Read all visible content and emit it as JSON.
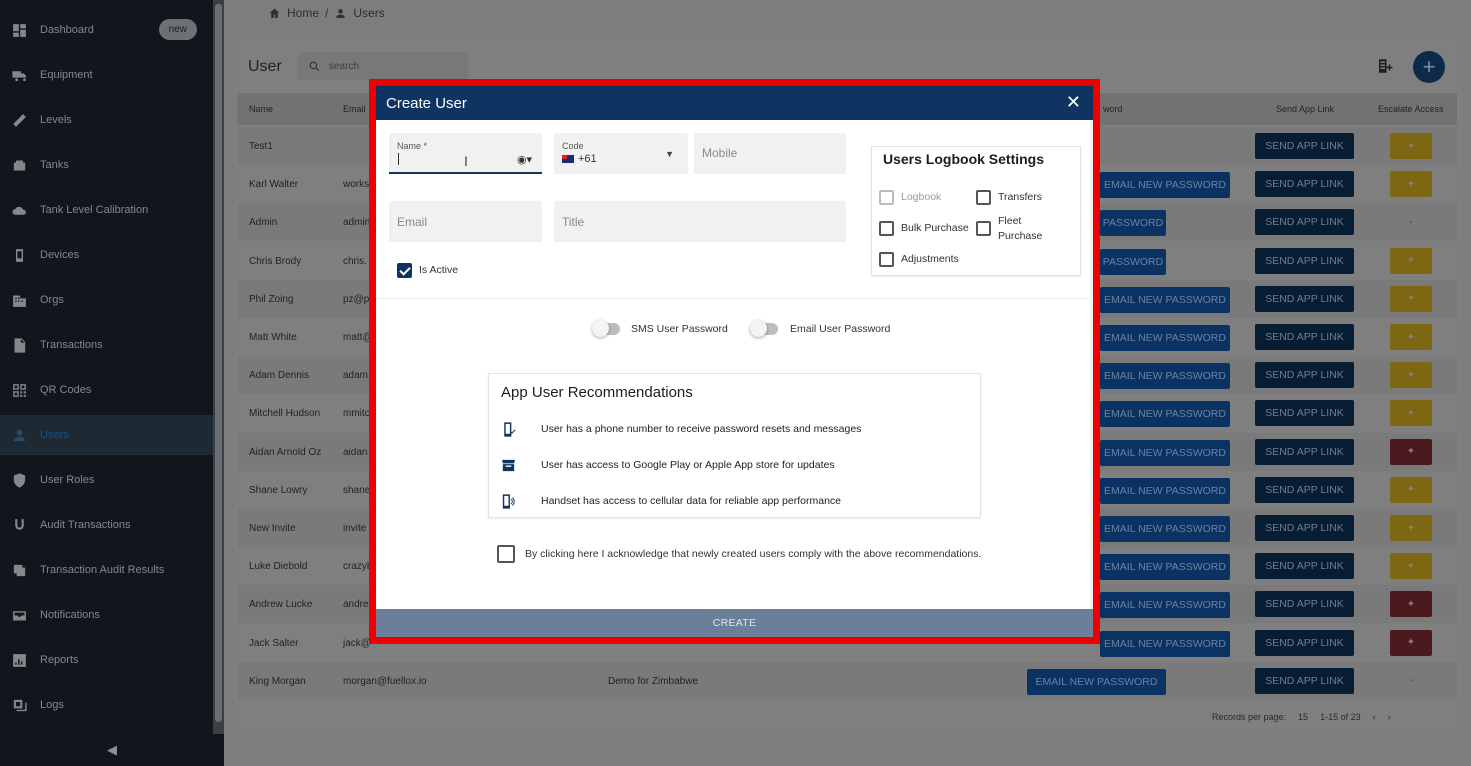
{
  "sidebar": {
    "items": [
      {
        "label": "Dashboard",
        "badge": "new"
      },
      {
        "label": "Equipment"
      },
      {
        "label": "Levels"
      },
      {
        "label": "Tanks"
      },
      {
        "label": "Tank Level Calibration"
      },
      {
        "label": "Devices"
      },
      {
        "label": "Orgs"
      },
      {
        "label": "Transactions"
      },
      {
        "label": "QR Codes"
      },
      {
        "label": "Users"
      },
      {
        "label": "User Roles"
      },
      {
        "label": "Audit Transactions"
      },
      {
        "label": "Transaction Audit Results"
      },
      {
        "label": "Notifications"
      },
      {
        "label": "Reports"
      },
      {
        "label": "Logs"
      }
    ],
    "collapse_glyph": "◀"
  },
  "breadcrumb": {
    "home": "Home",
    "separator": "/",
    "current": "Users"
  },
  "page": {
    "title": "User",
    "search_placeholder": "search",
    "add_glyph": "+"
  },
  "table": {
    "headers": {
      "name": "Name",
      "email": "Email",
      "password": "word",
      "send": "Send App Link",
      "escalate": "Escalate Access"
    },
    "email_btn_label": "EMAIL NEW PASSWORD",
    "email_btn_short": "PASSWORD",
    "send_btn_label": "SEND APP LINK",
    "rows": [
      {
        "name": "Test1",
        "email": ""
      },
      {
        "name": "Karl Walter",
        "email": "works"
      },
      {
        "name": "Admin",
        "email": "admin"
      },
      {
        "name": "Chris Brody",
        "email": "chris."
      },
      {
        "name": "Phil Zoing",
        "email": "pz@p"
      },
      {
        "name": "Matt White",
        "email": "matt@"
      },
      {
        "name": "Adam Dennis",
        "email": "adam."
      },
      {
        "name": "Mitchell Hudson",
        "email": "mmitc"
      },
      {
        "name": "Aidan Arnold Oz",
        "email": "aidan"
      },
      {
        "name": "Shane Lowry",
        "email": "shane"
      },
      {
        "name": "New Invite",
        "email": "invite"
      },
      {
        "name": "Luke Diebold",
        "email": "crazyb"
      },
      {
        "name": "Andrew Lucke",
        "email": "andre"
      },
      {
        "name": "Jack Salter",
        "email": "jack@"
      },
      {
        "name": "King Morgan",
        "email": "morgan@fuellox.io",
        "org": "Demo for Zimbabwe"
      }
    ],
    "dash": "-"
  },
  "pager": {
    "label": "Records per page:",
    "per_page": "15",
    "range": "1-15 of 23",
    "prev": "‹",
    "next": "›"
  },
  "modal": {
    "title": "Create User",
    "close_glyph": "✕",
    "name_label": "Name *",
    "code_label": "Code",
    "code_value": "+61",
    "mobile_placeholder": "Mobile",
    "email_placeholder": "Email",
    "title_placeholder": "Title",
    "is_active_label": "Is Active",
    "logbook": {
      "title": "Users Logbook Settings",
      "logbook": "Logbook",
      "transfers": "Transfers",
      "bulk_purchase": "Bulk Purchase",
      "fleet_purchase": "Fleet Purchase",
      "adjustments": "Adjustments"
    },
    "sms_toggle_label": "SMS User Password",
    "email_toggle_label": "Email User Password",
    "recommendations": {
      "title": "App User Recommendations",
      "items": [
        "User has a phone number to receive password resets and messages",
        "User has access to Google Play or Apple App store for updates",
        "Handset has access to cellular data for reliable app performance"
      ]
    },
    "ack_label": "By clicking here I acknowledge that newly created users comply with the above recommendations.",
    "create_label": "CREATE"
  },
  "colors": {
    "modal_header": "#0f3461",
    "highlight_frame": "#ee0000",
    "create_bar": "#6c7f98"
  }
}
